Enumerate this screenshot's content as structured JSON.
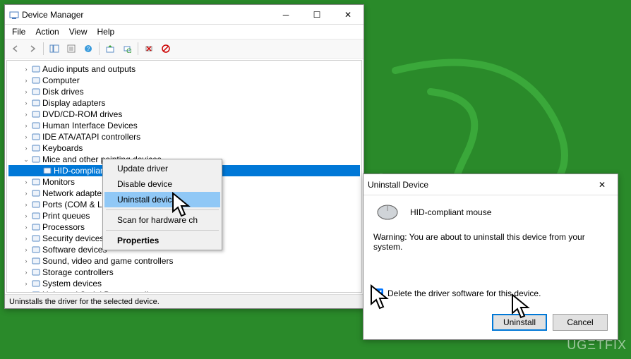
{
  "devmgr": {
    "title": "Device Manager",
    "menubar": {
      "file": "File",
      "action": "Action",
      "view": "View",
      "help": "Help"
    },
    "statusbar": "Uninstalls the driver for the selected device.",
    "tree": {
      "items": [
        {
          "label": "Audio inputs and outputs",
          "indent": 1
        },
        {
          "label": "Computer",
          "indent": 1
        },
        {
          "label": "Disk drives",
          "indent": 1
        },
        {
          "label": "Display adapters",
          "indent": 1
        },
        {
          "label": "DVD/CD-ROM drives",
          "indent": 1
        },
        {
          "label": "Human Interface Devices",
          "indent": 1
        },
        {
          "label": "IDE ATA/ATAPI controllers",
          "indent": 1
        },
        {
          "label": "Keyboards",
          "indent": 1
        },
        {
          "label": "Mice and other pointing devices",
          "indent": 1,
          "expanded": true
        },
        {
          "label": "HID-compliant mouse",
          "indent": 2,
          "selected": true
        },
        {
          "label": "Monitors",
          "indent": 1
        },
        {
          "label": "Network adapters",
          "indent": 1
        },
        {
          "label": "Ports (COM & LPT)",
          "indent": 1
        },
        {
          "label": "Print queues",
          "indent": 1
        },
        {
          "label": "Processors",
          "indent": 1
        },
        {
          "label": "Security devices",
          "indent": 1
        },
        {
          "label": "Software devices",
          "indent": 1
        },
        {
          "label": "Sound, video and game controllers",
          "indent": 1
        },
        {
          "label": "Storage controllers",
          "indent": 1
        },
        {
          "label": "System devices",
          "indent": 1
        },
        {
          "label": "Universal Serial Bus controllers",
          "indent": 1
        }
      ]
    }
  },
  "context_menu": {
    "items": [
      {
        "label": "Update driver"
      },
      {
        "label": "Disable device"
      },
      {
        "label": "Uninstall device",
        "hover": true
      },
      {
        "sep": true
      },
      {
        "label": "Scan for hardware changes",
        "display": "Scan for hardware ch"
      },
      {
        "sep": true
      },
      {
        "label": "Properties",
        "bold": true
      }
    ]
  },
  "dialog": {
    "title": "Uninstall Device",
    "device_name": "HID-compliant mouse",
    "warning": "Warning: You are about to uninstall this device from your system.",
    "checkbox_label": "Delete the driver software for this device.",
    "checkbox_checked": true,
    "buttons": {
      "uninstall": "Uninstall",
      "cancel": "Cancel"
    }
  },
  "watermark": "UGΞTFIX"
}
